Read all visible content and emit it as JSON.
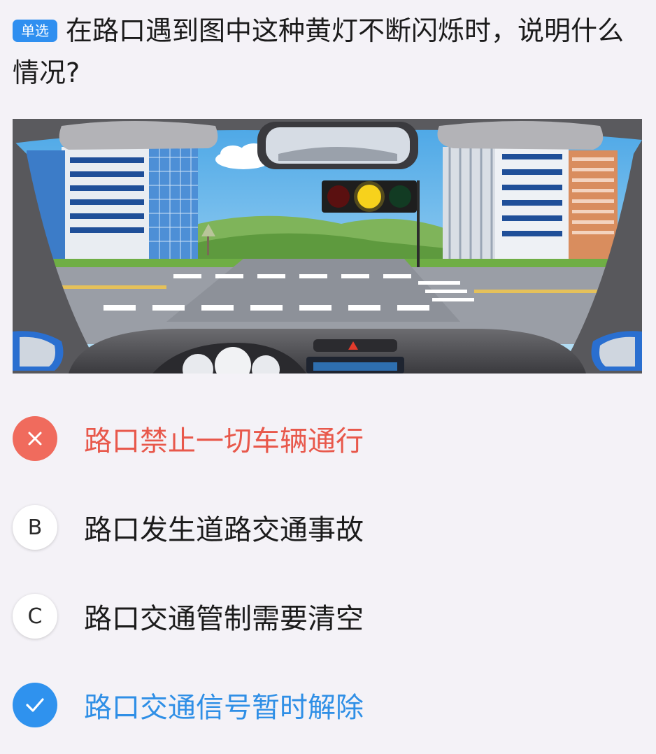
{
  "question": {
    "type_badge": "单选",
    "text": "在路口遇到图中这种黄灯不断闪烁时，说明什么情况?"
  },
  "illustration": {
    "subject": "driver-view-intersection-flashing-yellow-light",
    "light_state": "yellow"
  },
  "options": [
    {
      "marker": "",
      "marker_icon": "cross-icon",
      "text": "路口禁止一切车辆通行",
      "state": "wrong"
    },
    {
      "marker": "B",
      "text": "路口发生道路交通事故",
      "state": "normal"
    },
    {
      "marker": "C",
      "text": "路口交通管制需要清空",
      "state": "normal"
    },
    {
      "marker": "",
      "marker_icon": "check-icon",
      "text": "路口交通信号暂时解除",
      "state": "correct"
    }
  ],
  "colors": {
    "badge": "#2f8ff0",
    "wrong": "#f06b5d",
    "correct": "#2f92ee",
    "background": "#f4f2f7"
  }
}
